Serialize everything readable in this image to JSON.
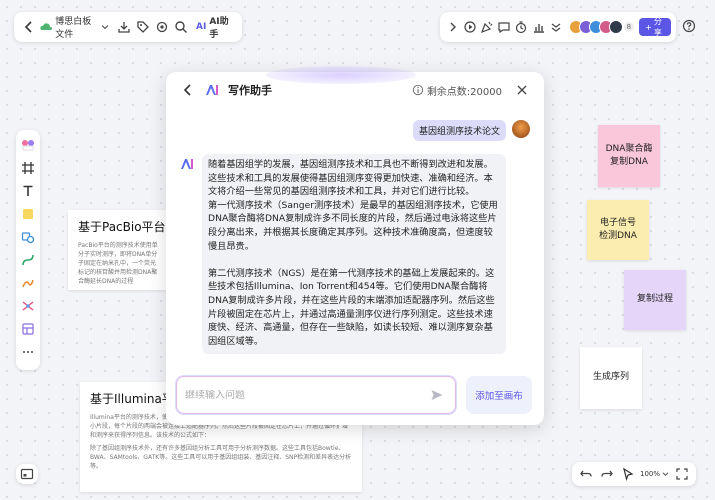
{
  "toolbar": {
    "doc_title": "博思白板文件",
    "ai_label": "AI助手",
    "ai_logo": "AI",
    "share_label": "分享",
    "avatar_count": "8"
  },
  "zoom": {
    "level": "100%"
  },
  "cards": [
    {
      "title": "基于PacBio平台的",
      "body": "PacBio平台的测序技术使用单分子实时测序，即将DNA单分子固定在纳米孔中，一个荧光标记的核苷酸并用检测DNA聚合酶延长DNA的过程"
    },
    {
      "title": "基于Illumina平",
      "body": "Illumina平台的测序技术，使用的是边合成边测序的方法。在这种方法中，DNA片段被随机切割成小片段，每个片段的两端会被连接上适配器序列。然后这些片段被固定在芯片上，并通过循环扩增和测序来获得序列信息。该技术的公式如下：",
      "body2": "除了基因组测序技术外，还有许多基因组分析工具可用于分析测序数据。这些工具包括Bowtie、BWA、SAMtools、GATK等。这些工具可以用于基因组组装、基因注释、SNP检测和差异表达分析等。"
    }
  ],
  "stickies": [
    "DNA聚合酶\n复制DNA",
    "电子信号\n检测DNA",
    "复制过程",
    "生成序列"
  ],
  "dialog": {
    "title": "写作助手",
    "credits": "剩余点数:20000",
    "user_message": "基因组测序技术论文",
    "ai_paragraphs": [
      "随着基因组学的发展，基因组测序技术和工具也不断得到改进和发展。这些技术和工具的发展使得基因组测序变得更加快速、准确和经济。本文将介绍一些常见的基因组测序技术和工具，并对它们进行比较。\n第一代测序技术（Sanger测序技术）是最早的基因组测序技术，它使用DNA聚合酶将DNA复制成许多不同长度的片段，然后通过电泳将这些片段分离出来，并根据其长度确定其序列。这种技术准确度高，但速度较慢且昂贵。",
      "第二代测序技术（NGS）是在第一代测序技术的基础上发展起来的。这些技术包括Illumina、Ion Torrent和454等。它们使用DNA聚合酶将DNA复制成许多片段，并在这些片段的末端添加适配器序列。然后这些片段被固定在芯片上，并通过高通量测序仪进行序列测定。这些技术速度快、经济、高通量，但存在一些缺陷，如读长较短、难以测序复杂基因组区域等。"
    ],
    "input_placeholder": "继续输入问题",
    "input_value": "",
    "add_button": "添加至画布"
  },
  "colors": {
    "accent": "#5b56e6",
    "sticky_pink": "#f9c6da",
    "sticky_yellow": "#fbedb0",
    "sticky_purple": "#e4d5f9"
  }
}
